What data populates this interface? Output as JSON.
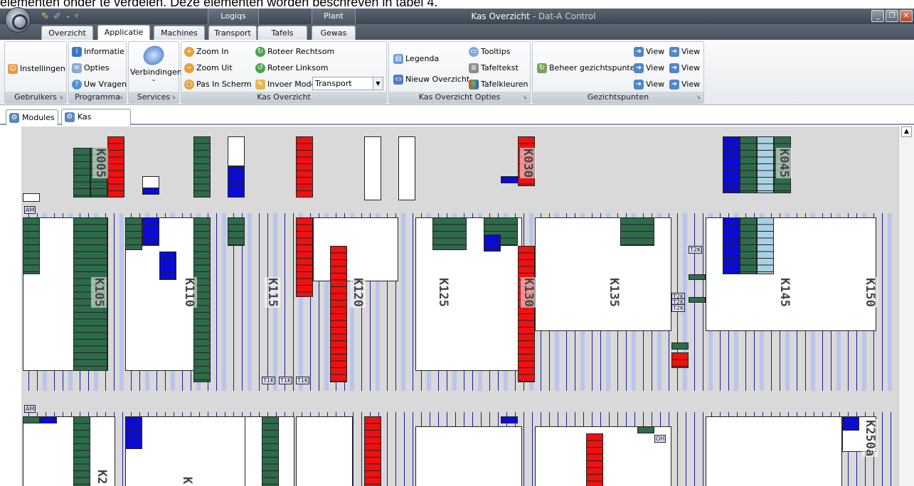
{
  "caption": "elementen onder te verdelen. Deze elementen worden beschreven in tabel 4.",
  "window": {
    "title": "Kas Overzicht",
    "subtitle": "- Dat-A Control",
    "context_tabs": [
      "Logiqs",
      "Plant"
    ]
  },
  "ribbon_tabs": [
    "Overzicht",
    "Applicatie",
    "Machines",
    "Transport",
    "Tafels",
    "Gewas"
  ],
  "active_tab": "Applicatie",
  "groups": {
    "gebruikers": {
      "label": "Gebruikers",
      "instellingen": "Instellingen"
    },
    "programma": {
      "label": "Programma",
      "informatie": "Informatie",
      "opties": "Opties",
      "uw_vragen": "Uw Vragen"
    },
    "services": {
      "label": "Services",
      "verbindingen": "Verbindingen"
    },
    "kas_overzicht": {
      "label": "Kas Overzicht",
      "zoom_in": "Zoom In",
      "zoom_uit": "Zoom Uit",
      "pas_in_scherm": "Pas In Scherm",
      "roteer_rechtsom": "Roteer Rechtsom",
      "roteer_linksom": "Roteer Linksom",
      "invoer_mode": "Invoer Mode",
      "invoer_mode_value": "Transport"
    },
    "kas_overzicht_opties": {
      "label": "Kas Overzicht Opties",
      "legenda": "Legenda",
      "nieuw_overzicht": "Nieuw Overzicht",
      "tooltips": "Tooltips",
      "tafeltekst": "Tafeltekst",
      "tafelkleuren": "Tafelkleuren"
    },
    "gezichtspunten": {
      "label": "Gezichtspunten",
      "beheer": "Beheer gezichtspunten",
      "view": "View"
    }
  },
  "doc_tabs": [
    "Modules",
    "Kas Overzicht"
  ],
  "active_doc_tab": "Kas Overzicht",
  "compartments_top": [
    "K005",
    "K030",
    "K045"
  ],
  "compartments_mid": [
    "K105",
    "K110",
    "K115",
    "K120",
    "K125",
    "K130",
    "K135",
    "K145",
    "K150"
  ],
  "compartments_bottom": [
    "K2",
    "K",
    "K250a"
  ],
  "tags": {
    "am": "AM",
    "t1k": "T1K",
    "t2k": "T2K",
    "oh": "OH"
  },
  "colors": {
    "green": "#2e6b4a",
    "red": "#ee1111",
    "blue": "#0b0bd6",
    "lightblue": "#a9d1e4",
    "canvas": "#d9d9d9"
  }
}
